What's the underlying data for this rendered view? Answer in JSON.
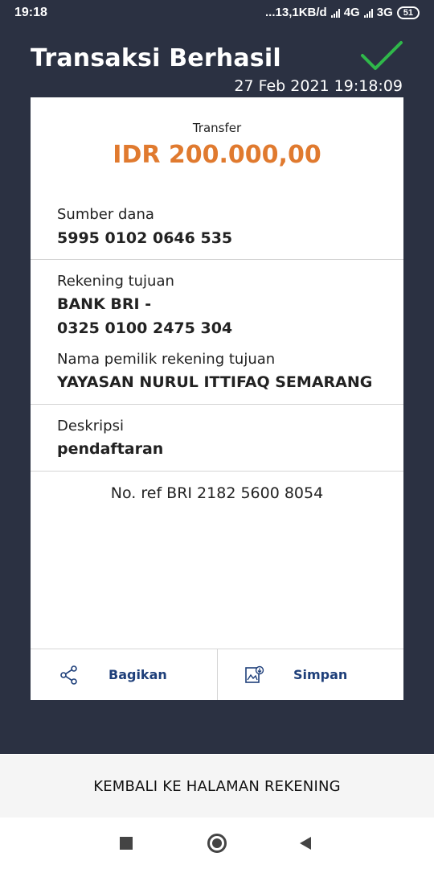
{
  "status_bar": {
    "time": "19:18",
    "network_speed": "...13,1KB/d",
    "network_4g": "4G",
    "network_3g": "3G",
    "battery": "51"
  },
  "header": {
    "title": "Transaksi Berhasil",
    "datetime": "27 Feb 2021 19:18:09",
    "check_icon": "checkmark-icon"
  },
  "receipt": {
    "type_label": "Transfer",
    "amount": "IDR 200.000,00",
    "source": {
      "label": "Sumber dana",
      "value": "5995 0102 0646 535"
    },
    "destination": {
      "label": "Rekening tujuan",
      "bank": "BANK BRI -",
      "account": "0325 0100 2475 304",
      "owner_label": "Nama pemilik rekening tujuan",
      "owner_name": "YAYASAN NURUL ITTIFAQ SEMARANG"
    },
    "description": {
      "label": "Deskripsi",
      "value": "pendaftaran"
    },
    "reference": "No. ref BRI 2182 5600 8054"
  },
  "actions": {
    "share_label": "Bagikan",
    "save_label": "Simpan"
  },
  "footer": {
    "back_button_label": "KEMBALI KE HALAMAN REKENING"
  },
  "colors": {
    "header_bg": "#2b3142",
    "amount": "#e07a2f",
    "action_text": "#1e3f7a",
    "check": "#2fb84a"
  }
}
